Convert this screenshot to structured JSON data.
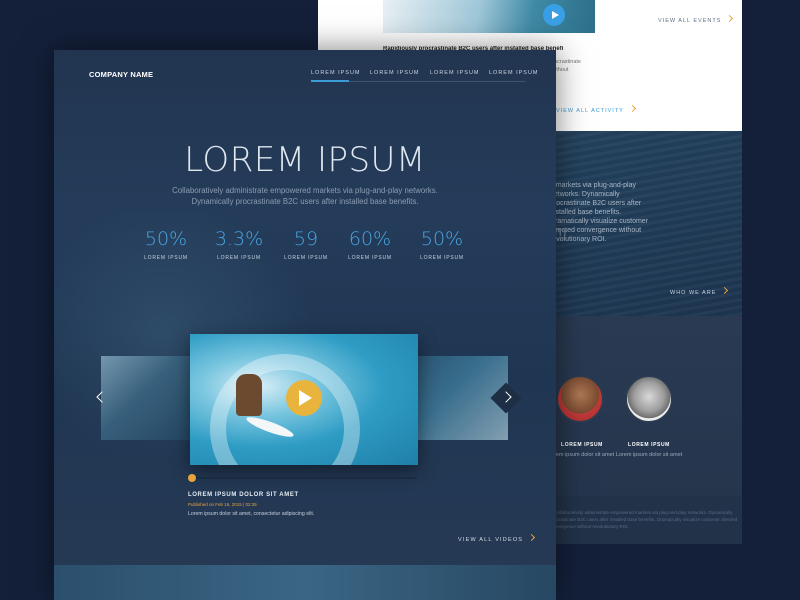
{
  "back_page": {
    "view_all_events": "VIEW ALL EVENTS",
    "event_title": "Rapidiously procrastinate B2C users after installed base benefits.",
    "event_desc": "Dynamically procrastinate convergence without",
    "view_activity": "VIEW ALL ACTIVITY",
    "about_text": "...markets via plug-and-play networks. Dynamically procrastinate B2C users after installed base benefits. Dramatically visualize customer directed convergence without revolutionary ROI.",
    "about_fragment": "rn",
    "who_we_are": "WHO WE ARE",
    "team": [
      {
        "name": "LOREM IPSUM",
        "desc": "Lorem ipsum dolor sit amet"
      },
      {
        "name": "LOREM IPSUM",
        "desc": "Lorem ipsum dolor sit amet"
      }
    ],
    "footer_text": "...Collaboratively administrate empowered markets via plug-and-play networks. Dynamically procrastinate B2C users after installed base benefits. Dramatically visualize customer directed convergence without revolutionary ROI."
  },
  "header": {
    "logo": "COMPANY NAME",
    "nav": [
      "LOREM IPSUM",
      "LOREM IPSUM",
      "LOREM IPSUM",
      "LOREM IPSUM"
    ]
  },
  "hero": {
    "title": "LOREM IPSUM",
    "subtitle_line1": "Collaboratively administrate empowered markets via plug-and-play networks.",
    "subtitle_line2": "Dynamically procrastinate B2C users after installed base benefits."
  },
  "stats": [
    {
      "value": "50%",
      "label": "LOREM IPSUM"
    },
    {
      "value": "3.3%",
      "label": "LOREM IPSUM"
    },
    {
      "value": "59",
      "label": "LOREM IPSUM"
    },
    {
      "value": "60%",
      "label": "LOREM IPSUM"
    },
    {
      "value": "50%",
      "label": "LOREM IPSUM"
    }
  ],
  "video": {
    "title": "LOREM IPSUM DOLOR SIT AMET",
    "meta": "Published on Feb 16, 2015  |  02:35",
    "description": "Lorem ipsum dolor sit amet, consectetur adipiscing elit.",
    "progress": 0.0
  },
  "view_all_videos": "VIEW ALL VIDEOS",
  "colors": {
    "accent_blue": "#4aa3e0",
    "accent_orange": "#e8a33c",
    "background": "#14203a"
  }
}
